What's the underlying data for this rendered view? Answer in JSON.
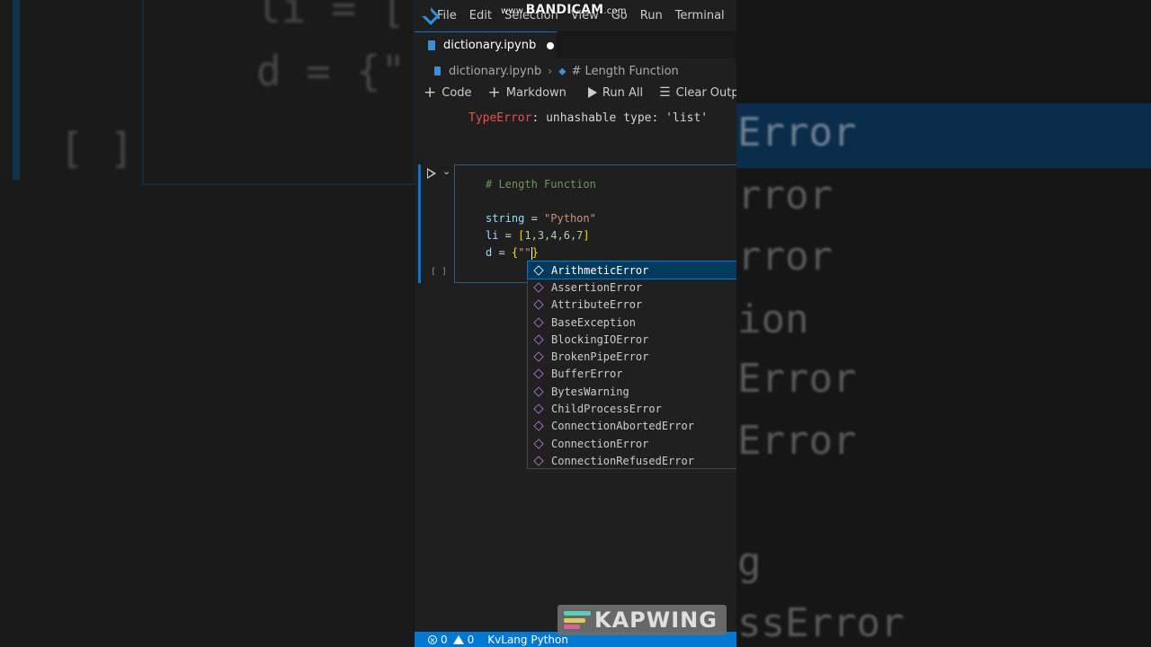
{
  "watermark": {
    "prefix": "www.",
    "brand": "BANDICAM",
    "suffix": ".com"
  },
  "menu": [
    "File",
    "Edit",
    "Selection",
    "View",
    "Go",
    "Run",
    "Terminal"
  ],
  "tab": {
    "title": "dictionary.ipynb"
  },
  "breadcrumb": {
    "file": "dictionary.ipynb",
    "section": "# Length Function"
  },
  "toolbar": {
    "code": "Code",
    "markdown": "Markdown",
    "run_all": "Run All",
    "clear": "Clear Outputs"
  },
  "error_output": {
    "type": "TypeError",
    "message": ": unhashable type: 'list'"
  },
  "cell": {
    "exec_count": "[ ]",
    "comment": "# Length Function",
    "line_string_var": "string",
    "line_string_eq": " = ",
    "line_string_val": "\"Python\"",
    "line_list_var": "li",
    "line_list_eq": " = ",
    "line_list_open": "[",
    "line_list_vals": "1,3,4,6,7",
    "line_list_close": "]",
    "line_dict_var": "d",
    "line_dict_eq": " = ",
    "line_dict_open": "{",
    "line_dict_str": "\"\"",
    "line_dict_close": "}"
  },
  "suggestions": [
    "ArithmeticError",
    "AssertionError",
    "AttributeError",
    "BaseException",
    "BlockingIOError",
    "BrokenPipeError",
    "BufferError",
    "BytesWarning",
    "ChildProcessError",
    "ConnectionAbortedError",
    "ConnectionError",
    "ConnectionRefusedError"
  ],
  "status": {
    "errors": "0",
    "warnings": "0",
    "kernel": "KvLang Python"
  },
  "kapwing": {
    "label": "KAPWING",
    "colors": [
      "#5ee0c8",
      "#f0d860",
      "#e86aa0"
    ]
  },
  "background": {
    "left_lines": [
      "li = [",
      "d = {\"",
      "[ ]"
    ],
    "right_words": [
      "Error",
      "rror",
      "rror",
      "ion",
      "Error",
      "Error",
      "g",
      "ssError"
    ]
  },
  "colors": {
    "accent": "#0078d4",
    "error": "#f14c4c",
    "comment": "#6a9955"
  }
}
